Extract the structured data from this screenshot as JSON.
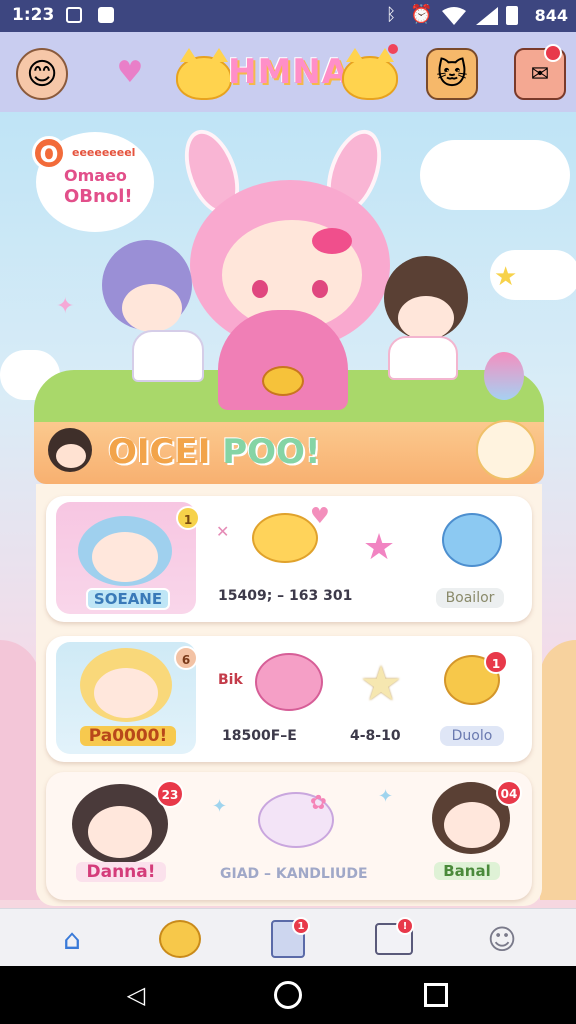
{
  "status_bar": {
    "time": "1:23",
    "battery": "844",
    "icons": [
      "image-icon",
      "notification-icon",
      "bluetooth-icon",
      "alarm-icon",
      "wifi-icon",
      "signal-icon",
      "battery-icon"
    ]
  },
  "app_bar": {
    "title": "HMNA",
    "left_icons": [
      "avatar-icon",
      "heart-icon"
    ],
    "right_icons": [
      "cat-avatar-icon",
      "mail-icon"
    ]
  },
  "hero": {
    "bubble_badge": "O",
    "bubble_line1": "eeeeeeeel",
    "bubble_line2": "Omaeo",
    "bubble_line3": "OBnol!"
  },
  "banner": {
    "text_a": "OICEI ",
    "text_b": "POO!"
  },
  "rows": [
    {
      "portrait_label": "SOEANE",
      "badge": "1",
      "stats": "15409; – 163 301",
      "pill": "Boailor"
    },
    {
      "portrait_label": "Pa0000!",
      "badge": "6",
      "side_text": "Bik",
      "stats": "18500F–E",
      "stats2": "4-8-10",
      "pill": "Duolo",
      "item_badge": "1"
    },
    {
      "portrait_label": "Danna!",
      "badge": "23",
      "stats": "GIAD – KANDLIUDE",
      "right_label": "Banal",
      "right_badge": "04"
    }
  ],
  "bottom_nav": {
    "items": [
      "home",
      "chat",
      "list",
      "mail",
      "profile"
    ],
    "list_badge": "1",
    "mail_badge": "!"
  },
  "colors": {
    "status_bar": "#3d4680",
    "app_bar": "#c9cdf0",
    "accent_pink": "#f07fb6",
    "banner_orange": "#f8b070"
  }
}
